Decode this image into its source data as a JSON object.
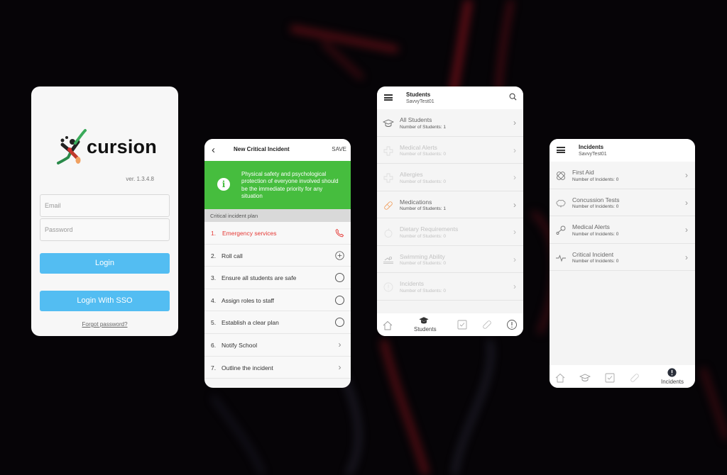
{
  "login_screen": {
    "logo_text": "cursion",
    "version": "ver. 1.3.4.8",
    "email_placeholder": "Email",
    "password_placeholder": "Password",
    "login_label": "Login",
    "sso_label": "Login With SSO",
    "forgot_label": "Forgot password?"
  },
  "critical_incident_screen": {
    "title": "New Critical Incident",
    "save_label": "SAVE",
    "banner_text": "Physical safety and psychological protection of everyone involved should be the immediate priority for any situation",
    "section_title": "Critical incident plan",
    "items": [
      {
        "num": "1.",
        "label": "Emergency services",
        "icon": "phone-icon",
        "highlight": true
      },
      {
        "num": "2.",
        "label": "Roll call",
        "icon": "plus-circle-icon"
      },
      {
        "num": "3.",
        "label": "Ensure all students are safe",
        "icon": "circle-icon"
      },
      {
        "num": "4.",
        "label": "Assign roles to staff",
        "icon": "circle-icon"
      },
      {
        "num": "5.",
        "label": "Establish a clear plan",
        "icon": "circle-icon"
      },
      {
        "num": "6.",
        "label": "Notify School",
        "icon": "chevron-right-icon"
      },
      {
        "num": "7.",
        "label": "Outline the incident",
        "icon": "chevron-right-icon"
      }
    ]
  },
  "students_screen": {
    "title": "Students",
    "subtitle": "SavvyTest01",
    "rows": [
      {
        "title": "All Students",
        "subtitle": "Number of Students: 1",
        "icon": "graduation-cap-icon",
        "dim": false
      },
      {
        "title": "Medical Alerts",
        "subtitle": "Number of Students: 0",
        "icon": "medical-cross-icon",
        "dim": true
      },
      {
        "title": "Allergies",
        "subtitle": "Number of Students: 0",
        "icon": "medical-cross-icon",
        "dim": true
      },
      {
        "title": "Medications",
        "subtitle": "Number of Students: 1",
        "icon": "pill-icon",
        "dim": false
      },
      {
        "title": "Dietary Requirements",
        "subtitle": "Number of Students: 0",
        "icon": "apple-icon",
        "dim": true
      },
      {
        "title": "Swimming Ability",
        "subtitle": "Number of Students: 0",
        "icon": "swimmer-icon",
        "dim": true
      },
      {
        "title": "Incidents",
        "subtitle": "Number of Students: 0",
        "icon": "alert-circle-icon",
        "dim": true
      }
    ],
    "tabbar": {
      "active_label": "Students"
    }
  },
  "incidents_screen": {
    "title": "Incidents",
    "subtitle": "SavvyTest01",
    "rows": [
      {
        "title": "First Aid",
        "subtitle": "Number of Incidents: 0",
        "icon": "bandage-icon"
      },
      {
        "title": "Concussion Tests",
        "subtitle": "Number of Incidents: 0",
        "icon": "brain-icon"
      },
      {
        "title": "Medical Alerts",
        "subtitle": "Number of Incidents: 0",
        "icon": "stethoscope-icon"
      },
      {
        "title": "Critical Incident",
        "subtitle": "Number of Incidents: 0",
        "icon": "heartbeat-icon"
      }
    ],
    "tabbar": {
      "active_label": "Incidents"
    }
  },
  "colors": {
    "primary_blue": "#53bdf2",
    "banner_green": "#46bd3e",
    "emergency_red": "#e53935",
    "medication_orange": "#f0a060"
  }
}
